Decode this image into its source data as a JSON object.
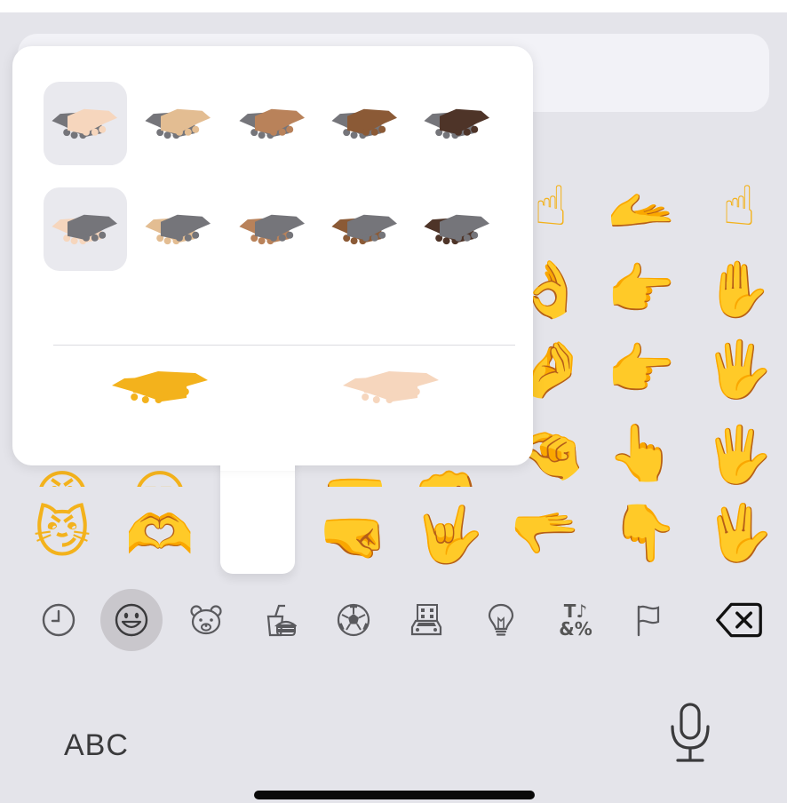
{
  "colors": {
    "keyboard_bg": "#e4e4ea",
    "popover_bg": "#ffffff",
    "emoji_yellow": "#f3b21c",
    "selected_cell": "#e9e9ee",
    "active_category": "#c9c7cc",
    "icon_gray": "#5a5a5e"
  },
  "skin_tones": [
    "#f6d6bd",
    "#e3bd92",
    "#b9825a",
    "#8b5a36",
    "#4e3428"
  ],
  "popover": {
    "row1": [
      {
        "icon": "handshake-light-left"
      },
      {
        "icon": "handshake-medium-light-left"
      },
      {
        "icon": "handshake-medium-left"
      },
      {
        "icon": "handshake-medium-dark-left"
      },
      {
        "icon": "handshake-dark-left"
      }
    ],
    "row2": [
      {
        "icon": "handshake-light-right"
      },
      {
        "icon": "handshake-medium-light-right"
      },
      {
        "icon": "handshake-medium-right"
      },
      {
        "icon": "handshake-medium-dark-right"
      },
      {
        "icon": "handshake-dark-right"
      }
    ],
    "default_choices": [
      {
        "icon": "handshake-yellow"
      },
      {
        "icon": "handshake-light"
      }
    ]
  },
  "grid_emojis": [
    {
      "char": "☝",
      "icon": "index-pointing-up"
    },
    {
      "char": "🫴",
      "icon": "palm-up-hand"
    },
    {
      "char": "☝",
      "icon": "index-pointing-up-2"
    },
    {
      "char": "👌",
      "icon": "ok-hand"
    },
    {
      "char": "👉",
      "icon": "backhand-index-pointing-right"
    },
    {
      "char": "✋",
      "icon": "raised-hand"
    },
    {
      "char": "🤌",
      "icon": "pinched-fingers"
    },
    {
      "char": "👉",
      "icon": "index-pointing-right-2"
    },
    {
      "char": "🖐",
      "icon": "hand-with-fingers-splayed"
    },
    {
      "char": "🤏",
      "icon": "pinching-hand"
    },
    {
      "char": "👆",
      "icon": "backhand-index-pointing-up"
    },
    {
      "char": "🖐",
      "icon": "hand-splayed-2"
    },
    {
      "char": "😼",
      "icon": "cat-with-wry-smile"
    },
    {
      "char": "🫶",
      "icon": "heart-hands"
    },
    {
      "char": "🤜",
      "icon": "right-facing-fist"
    },
    {
      "char": "🤟",
      "icon": "love-you-gesture"
    },
    {
      "char": "🫳",
      "icon": "palm-down-hand"
    },
    {
      "char": "👇",
      "icon": "backhand-index-pointing-down"
    },
    {
      "char": "🖖",
      "icon": "vulcan-salute"
    },
    {
      "char": "😠",
      "icon": "partial-face-1"
    },
    {
      "char": "😒",
      "icon": "partial-face-2"
    },
    {
      "char": "🤛",
      "icon": "partial-fist-1"
    },
    {
      "char": "👊",
      "icon": "partial-fist-2"
    }
  ],
  "categories": [
    {
      "icon": "clock-icon",
      "label": "Frequently Used"
    },
    {
      "icon": "smiley-icon",
      "label": "Smileys & People",
      "active": true
    },
    {
      "icon": "bear-icon",
      "label": "Animals & Nature"
    },
    {
      "icon": "food-icon",
      "label": "Food & Drink"
    },
    {
      "icon": "soccer-ball-icon",
      "label": "Activity"
    },
    {
      "icon": "building-car-icon",
      "label": "Travel & Places"
    },
    {
      "icon": "lightbulb-icon",
      "label": "Objects"
    },
    {
      "icon": "symbols-icon",
      "label": "Symbols",
      "glyph_top": "T♪",
      "glyph_bottom": "&%"
    },
    {
      "icon": "flag-icon",
      "label": "Flags"
    },
    {
      "icon": "delete-icon",
      "label": "Delete"
    }
  ],
  "keyboard": {
    "abc_label": "ABC",
    "mic_icon": "microphone-icon"
  }
}
